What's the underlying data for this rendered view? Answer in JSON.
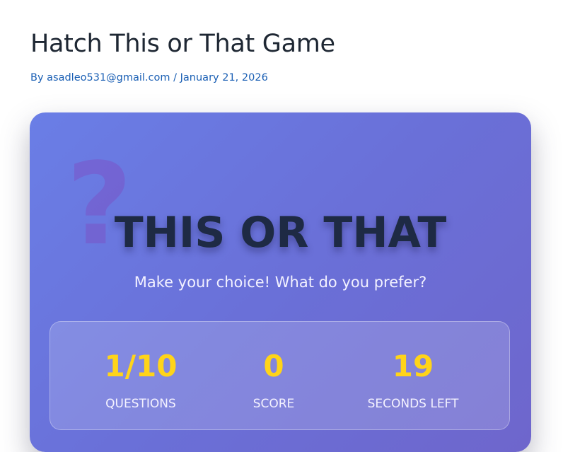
{
  "header": {
    "title": "Hatch This or That Game",
    "byline_prefix": "By ",
    "author": "asadleo531@gmail.com",
    "separator": " / ",
    "date": "January 21, 2026"
  },
  "game": {
    "decor_icon": "question-mark-icon",
    "decor_glyph": "?",
    "title": "THIS OR THAT",
    "subtitle": "Make your choice! What do you prefer?",
    "stats": {
      "questions": {
        "value": "1/10",
        "label": "QUESTIONS"
      },
      "score": {
        "value": "0",
        "label": "SCORE"
      },
      "seconds": {
        "value": "19",
        "label": "SECONDS LEFT"
      }
    }
  },
  "colors": {
    "title_text": "#1e2733",
    "link": "#1a5fb4",
    "card_gradient_start": "#6a7ee6",
    "card_gradient_end": "#6e66cc",
    "stat_value": "#ffd419",
    "game_title": "#1e2a44"
  }
}
